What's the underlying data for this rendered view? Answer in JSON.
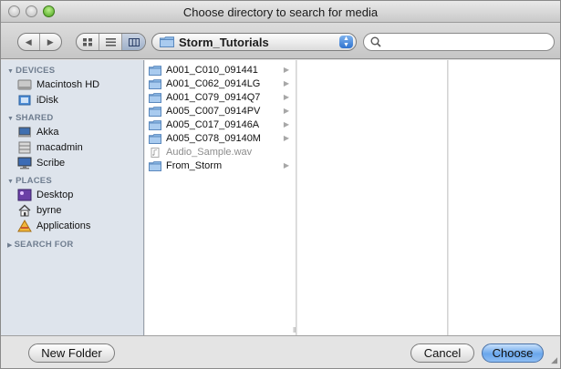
{
  "window": {
    "title": "Choose directory to search for media"
  },
  "toolbar": {
    "back_icon": "triangle-left",
    "forward_icon": "triangle-right",
    "view_modes": [
      "icon-view",
      "list-view",
      "column-view"
    ],
    "active_view": "column-view",
    "location_label": "Storm_Tutorials",
    "search": {
      "value": "",
      "placeholder": ""
    }
  },
  "sidebar": {
    "sections": {
      "devices": "DEVICES",
      "shared": "SHARED",
      "places": "PLACES",
      "search_for": "SEARCH FOR"
    },
    "devices": [
      {
        "label": "Macintosh HD",
        "icon": "hard-drive-icon"
      },
      {
        "label": "iDisk",
        "icon": "idisk-icon"
      }
    ],
    "shared": [
      {
        "label": "Akka",
        "icon": "computer-icon"
      },
      {
        "label": "macadmin",
        "icon": "server-icon"
      },
      {
        "label": "Scribe",
        "icon": "monitor-icon"
      }
    ],
    "places": [
      {
        "label": "Desktop",
        "icon": "desktop-icon"
      },
      {
        "label": "byrne",
        "icon": "home-icon"
      },
      {
        "label": "Applications",
        "icon": "applications-icon"
      }
    ]
  },
  "columns": {
    "first": [
      {
        "label": "A001_C010_091441",
        "type": "folder"
      },
      {
        "label": "A001_C062_0914LG",
        "type": "folder"
      },
      {
        "label": "A001_C079_0914Q7",
        "type": "folder"
      },
      {
        "label": "A005_C007_0914PV",
        "type": "folder"
      },
      {
        "label": "A005_C017_09146A",
        "type": "folder"
      },
      {
        "label": "A005_C078_09140M",
        "type": "folder"
      },
      {
        "label": "Audio_Sample.wav",
        "type": "file"
      },
      {
        "label": "From_Storm",
        "type": "folder"
      }
    ]
  },
  "buttons": {
    "new_folder": "New Folder",
    "cancel": "Cancel",
    "choose": "Choose"
  },
  "colors": {
    "accent": "#4a8fe0",
    "sidebar_bg": "#dee4ec",
    "folder": "#7fb0e3"
  }
}
